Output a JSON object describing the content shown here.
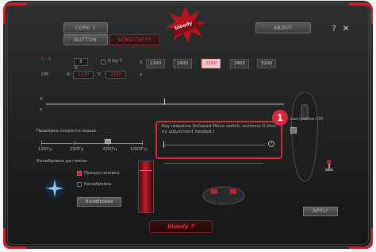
{
  "window": {
    "title_buttons": {
      "help": "?",
      "close": "✕"
    }
  },
  "tabs": [
    {
      "label": "CORE 1",
      "selected": false
    },
    {
      "label": "ABOUT",
      "selected": false
    },
    {
      "label": "BUTTON",
      "selected": false
    },
    {
      "label": "SENSITIVITY",
      "selected": true
    }
  ],
  "logo": {
    "text": "bloody"
  },
  "cpi_section": {
    "top_left_label": "1 - 5",
    "cpi_label": "CPI",
    "x_value": "2100",
    "y_value": "2100",
    "checkbox_label": "X Oy Y",
    "x_letter": "X",
    "y_letter": "Y",
    "levels": [
      "1200",
      "1600",
      "2100",
      "2600",
      "3200"
    ],
    "selected_level": "2100"
  },
  "slider_row": {
    "x_letter": "X",
    "y_letter": "Y"
  },
  "polling": {
    "title": "Проверка скорости мыши",
    "options": [
      "125Гц",
      "250Гц",
      "500Гц",
      "1000Гц"
    ],
    "selected_index": 2
  },
  "key_response": {
    "text": "Key response (Infrared-Micro switch, extreme 0.2ms, no adjustment needed.)",
    "help": "?"
  },
  "calibration": {
    "title": "Калибровка датчиков",
    "option1": "Предустановка",
    "option2": "Калибровка",
    "button": "Калибровка"
  },
  "side_label": "настройки CPI",
  "apply_label": "APPLY",
  "annotation_number": "1",
  "bottom_logo": "bloody 7",
  "colors": {
    "accent": "#d6283a",
    "selected_tab": "#e23a3a"
  }
}
